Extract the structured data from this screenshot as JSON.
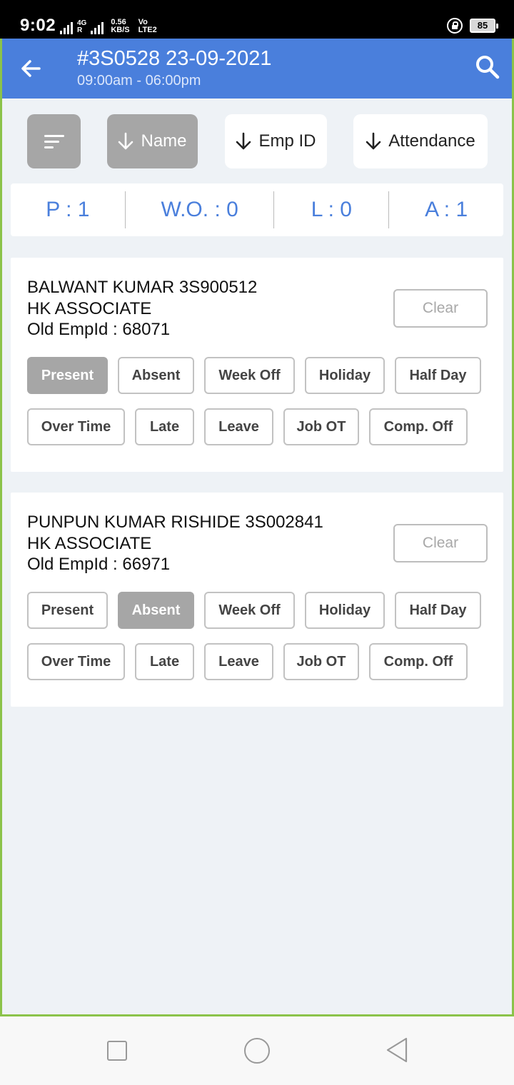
{
  "status_bar": {
    "time": "9:02",
    "network_small_top": "4G",
    "network_small_bottom": "R",
    "speed_value": "0.56",
    "speed_unit": "KB/S",
    "volte_top": "Vo",
    "volte_bottom": "LTE2",
    "battery": "85"
  },
  "header": {
    "title": "#3S0528 23-09-2021",
    "subtitle": "09:00am - 06:00pm",
    "back_icon": "arrow-left-icon",
    "search_icon": "search-icon"
  },
  "sort": {
    "filter_icon": "sort-lines-icon",
    "name": "Name",
    "emp_id": "Emp ID",
    "attendance": "Attendance"
  },
  "summary": {
    "present": "P : 1",
    "week_off": "W.O. : 0",
    "leave": "L : 0",
    "absent": "A : 1"
  },
  "employees": [
    {
      "name": "BALWANT KUMAR 3S900512",
      "role": "HK ASSOCIATE",
      "old_emp_id": "Old EmpId : 68071",
      "clear": "Clear",
      "selected": "Present"
    },
    {
      "name": "PUNPUN KUMAR RISHIDE 3S002841",
      "role": "HK ASSOCIATE",
      "old_emp_id": "Old EmpId : 66971",
      "clear": "Clear",
      "selected": "Absent"
    }
  ],
  "options": {
    "present": "Present",
    "absent": "Absent",
    "week_off": "Week Off",
    "holiday": "Holiday",
    "half_day": "Half Day",
    "over_time": "Over Time",
    "late": "Late",
    "leave": "Leave",
    "job_ot": "Job OT",
    "comp_off": "Comp. Off"
  },
  "colors": {
    "appbar": "#4a7fdc",
    "accent_text": "#4a7fdc",
    "selected_chip": "#a6a6a6",
    "frame_border": "#8bc34a",
    "background": "#eef2f6"
  }
}
